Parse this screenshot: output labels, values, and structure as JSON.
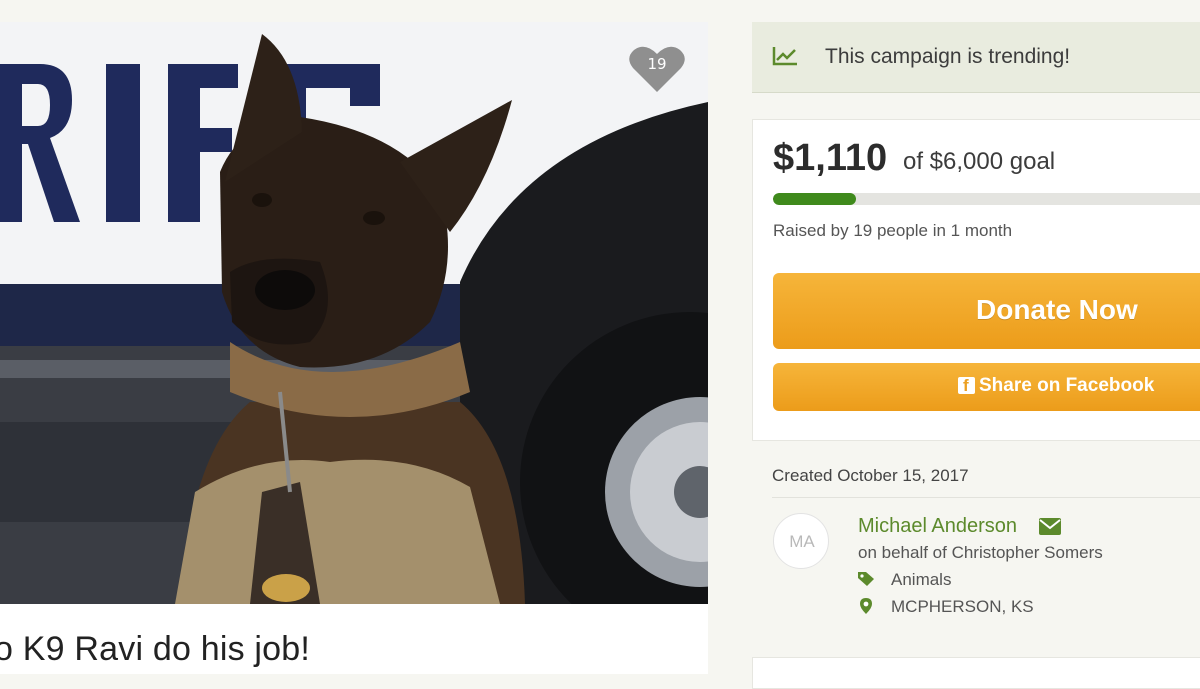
{
  "hero": {
    "heart_count": "19"
  },
  "campaign": {
    "title": "o K9 Ravi do his job!"
  },
  "trending": {
    "icon": "trending-chart-icon",
    "text": "This campaign is trending!"
  },
  "funding": {
    "raised": "$1,110",
    "goal_text": "of $6,000 goal",
    "progress_fraction": 0.185,
    "raised_by": "Raised by 19 people in 1 month",
    "progress_color": "#3f8a1c"
  },
  "actions": {
    "donate_label": "Donate Now",
    "share_label": "Share on Facebook",
    "button_color": "#f0a526"
  },
  "details": {
    "created": "Created October 15, 2017",
    "avatar_initials": "MA",
    "organizer": "Michael Anderson",
    "on_behalf": "on behalf of Christopher Somers",
    "category": "Animals",
    "location": "MCPHERSON, KS",
    "accent": "#5c8a2c"
  }
}
